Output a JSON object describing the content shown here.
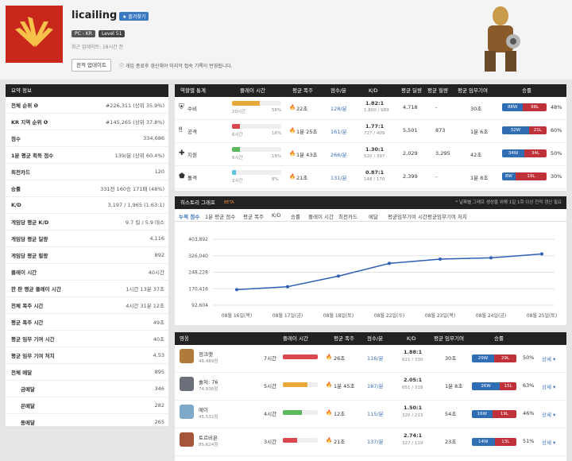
{
  "header": {
    "player_name": "licailing",
    "favorite_label": "★ 즐겨찾기",
    "platform": "PC - KR",
    "level": "Level 51",
    "updated": "최근 업데이트: 18시간 전",
    "update_button": "전적 업데이트",
    "note": "ⓘ 게임 종료후 경신해야 마지막 접속 기록이 반영됩니다."
  },
  "summary": {
    "title": "요약 정보",
    "rows": [
      {
        "k": "전체 순위 ❶",
        "v": "#226,311 (상위 35.9%)"
      },
      {
        "k": "KR 지역 순위 ❶",
        "v": "#145,265 (상위 37.8%)"
      },
      {
        "k": "점수",
        "v": "334,686"
      },
      {
        "k": "1분 평균 획득 점수",
        "v": "139/분 (상위 60.4%)"
      },
      {
        "k": "최전카드",
        "v": "120"
      },
      {
        "k": "승률",
        "v": "331전 160승 171패 (48%)"
      },
      {
        "k": "K/D",
        "v": "3,197 / 1,965 (1.63:1)"
      },
      {
        "k": "게임당 평균 K/D",
        "v": "9.7 킬 / 5.9 데스"
      },
      {
        "k": "게임당 평균 딜량",
        "v": "4,116"
      },
      {
        "k": "게임당 평균 힐량",
        "v": "892"
      },
      {
        "k": "플레이 시간",
        "v": "40시간"
      },
      {
        "k": "한 판 평균 플레이 시간",
        "v": "1시간 13분 37초"
      },
      {
        "k": "전체 폭주 시간",
        "v": "4시간 31분 12초"
      },
      {
        "k": "평균 폭주 시간",
        "v": "49초"
      },
      {
        "k": "평균 임무 기여 시간",
        "v": "40초"
      },
      {
        "k": "평균 임무 기여 처치",
        "v": "4.53"
      },
      {
        "k": "전체 메달",
        "v": "895"
      },
      {
        "k": "금메달",
        "v": "346",
        "sub": true
      },
      {
        "k": "은메달",
        "v": "282",
        "sub": true
      },
      {
        "k": "동메달",
        "v": "265",
        "sub": true
      }
    ]
  },
  "roles": {
    "headers": [
      "역할별 통계",
      "플레이 시간",
      "평균 폭주",
      "점수/분",
      "K/D",
      "평균 딜량",
      "평균 힐량",
      "평균 임무기여",
      "승률"
    ],
    "rows": [
      {
        "name": "수비",
        "time": "20시간",
        "pct": "56%",
        "bar": 0.56,
        "color": "#e8a93a",
        "fire": "22초",
        "spm": "128/분",
        "kd": "1.82:1",
        "kd2": "1,800 / 989",
        "dmg": "4,718",
        "heal": "-",
        "obj": "30초",
        "w": "88W",
        "l": "98L",
        "rate": "48%",
        "wf": 0.47
      },
      {
        "name": "공격",
        "time": "6시간",
        "pct": "16%",
        "bar": 0.16,
        "color": "#d9484e",
        "fire": "1분 25초",
        "spm": "161/분",
        "kd": "1.77:1",
        "kd2": "727 / 409",
        "dmg": "5,501",
        "heal": "873",
        "obj": "1분 6초",
        "w": "32W",
        "l": "21L",
        "rate": "60%",
        "wf": 0.6
      },
      {
        "name": "지원",
        "time": "6시간",
        "pct": "16%",
        "bar": 0.16,
        "color": "#5cb85c",
        "fire": "1분 43초",
        "spm": "266/분",
        "kd": "1.30:1",
        "kd2": "520 / 397",
        "dmg": "2,029",
        "heal": "3,295",
        "obj": "42초",
        "w": "34W",
        "l": "34L",
        "rate": "50%",
        "wf": 0.5
      },
      {
        "name": "돌격",
        "time": "2시간",
        "pct": "8%",
        "bar": 0.08,
        "color": "#5bc0de",
        "fire": "21초",
        "spm": "131/분",
        "kd": "0.87:1",
        "kd2": "148 / 170",
        "dmg": "2,399",
        "heal": "-",
        "obj": "1분 8초",
        "w": "8W",
        "l": "19L",
        "rate": "30%",
        "wf": 0.3
      }
    ]
  },
  "history": {
    "title": "히스토리 그래프",
    "beta": "BETA",
    "note": "* 날짜별 그래프 생성을 위해 1일 1회 이상 전적 갱신 필요",
    "tabs": [
      "누적 점수",
      "1분 평균 점수",
      "평균 폭주",
      "K/D",
      "승률",
      "플레이 시간",
      "최전카드",
      "메달",
      "평균임무기여 시간",
      "평균임무기여 처치"
    ]
  },
  "chart_data": {
    "type": "line",
    "x": [
      "08월 16일(목)",
      "08월 17일(금)",
      "08월 18일(토)",
      "08월 22일(수)",
      "08월 23일(목)",
      "08월 24일(금)",
      "08월 25일(토)"
    ],
    "ylim": [
      92604,
      403892
    ],
    "yticks": [
      "403,892",
      "326,040",
      "248,228",
      "170,416",
      "92,604"
    ],
    "series": [
      {
        "values": [
          166000,
          180000,
          230000,
          290000,
          310000,
          316000,
          334686
        ]
      }
    ],
    "color": "#2f5fb5"
  },
  "heroes": {
    "headers": [
      "영웅",
      "플레이 시간",
      "평균 폭주",
      "점수/분",
      "K/D",
      "평균 임무기여",
      "승률"
    ],
    "more": "상세 ▾",
    "rows": [
      {
        "name": "정크랫",
        "score": "46,489점",
        "time": "7시간",
        "bar": 1.0,
        "color": "#d9484e",
        "fire": "26초",
        "spm": "116/분",
        "kd": "1.88:1",
        "kd2": "621 / 330",
        "obj": "30초",
        "w": "29W",
        "l": "29L",
        "rate": "50%",
        "wf": 0.5,
        "av": "#b07a3a"
      },
      {
        "name": "솔저: 76",
        "score": "74,936점",
        "time": "5시간",
        "bar": 0.7,
        "color": "#e8a93a",
        "fire": "1분 45초",
        "spm": "187/분",
        "kd": "2.05:1",
        "kd2": "651 / 318",
        "obj": "1분 8초",
        "w": "26W",
        "l": "15L",
        "rate": "63%",
        "wf": 0.63,
        "av": "#6b6f7a"
      },
      {
        "name": "메이",
        "score": "45,532점",
        "time": "4시간",
        "bar": 0.55,
        "color": "#5cb85c",
        "fire": "12초",
        "spm": "115/분",
        "kd": "1.50:1",
        "kd2": "320 / 213",
        "obj": "54초",
        "w": "16W",
        "l": "19L",
        "rate": "46%",
        "wf": 0.46,
        "av": "#7fa9c9"
      },
      {
        "name": "토르비욘",
        "score": "85,624점",
        "time": "3시간",
        "bar": 0.42,
        "color": "#d9484e",
        "fire": "21초",
        "spm": "137/분",
        "kd": "2.74:1",
        "kd2": "327 / 119",
        "obj": "23초",
        "w": "14W",
        "l": "13L",
        "rate": "51%",
        "wf": 0.51,
        "av": "#a5563a"
      }
    ]
  }
}
